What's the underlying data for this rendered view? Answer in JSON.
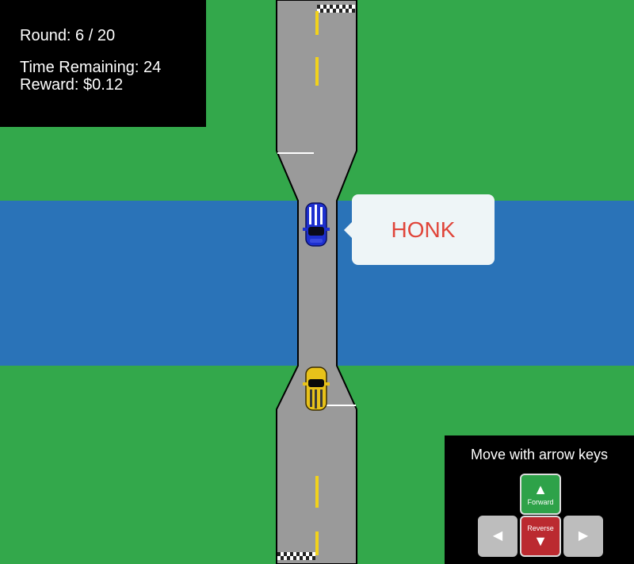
{
  "hud": {
    "round": "Round: 6 / 20",
    "time_remaining": "Time Remaining: 24",
    "reward": "Reward: $0.12"
  },
  "speech_bubble": {
    "text": "HONK"
  },
  "controls": {
    "title": "Move with arrow keys",
    "forward_label": "Forward",
    "reverse_label": "Reverse",
    "forward_glyph": "▲",
    "reverse_glyph": "▼",
    "left_glyph": "◀",
    "right_glyph": "▶"
  },
  "colors": {
    "grass": "#33a84b",
    "river": "#2a73b8",
    "road": "#9a9a9a",
    "lane_marking": "#f2d21a",
    "honk_text": "#e0453a",
    "forward_key": "#2ea249",
    "reverse_key": "#bb2a30",
    "blue_car": "#1d2fcf",
    "yellow_car": "#e8c21a"
  }
}
